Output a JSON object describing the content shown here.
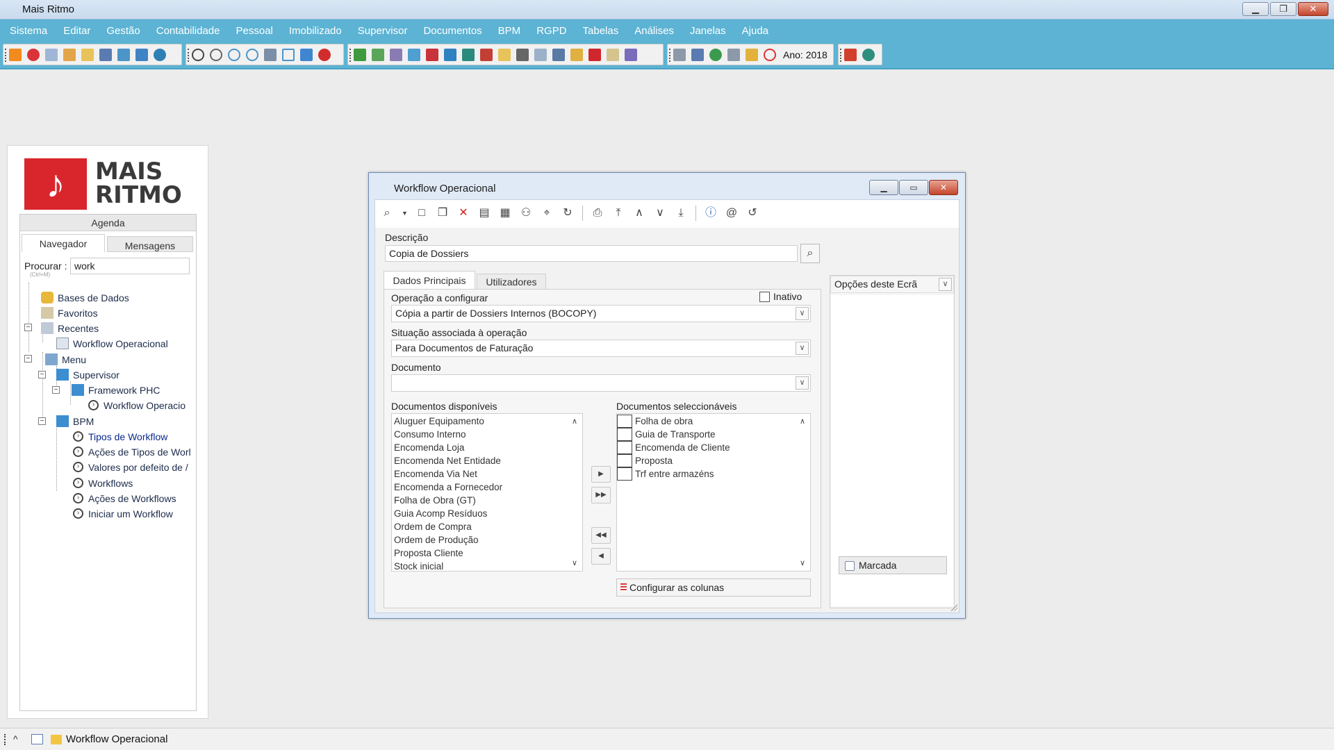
{
  "app": {
    "title": "Mais Ritmo",
    "window_controls": {
      "minimize": "▁",
      "restore": "❐",
      "close": "✕"
    }
  },
  "menu": [
    "Sistema",
    "Editar",
    "Gestão",
    "Contabilidade",
    "Pessoal",
    "Imobilizado",
    "Supervisor",
    "Documentos",
    "BPM",
    "RGPD",
    "Tabelas",
    "Análises",
    "Janelas",
    "Ajuda"
  ],
  "toolbar": {
    "year_label": "Ano: 2018"
  },
  "navigator": {
    "logo_glyph": "♪",
    "logo_line1": "MAIS",
    "logo_line2": "RITMO",
    "agenda": "Agenda",
    "tab_navigator": "Navegador",
    "tab_messages": "Mensagens",
    "search_label": "Procurar :",
    "search_hint": "(Ctrl+M)",
    "search_value": "work",
    "tree": {
      "bases": "Bases de Dados",
      "favoritos": "Favoritos",
      "recentes": "Recentes",
      "recent_workflow": "Workflow Operacional",
      "menu": "Menu",
      "supervisor": "Supervisor",
      "framework": "Framework PHC",
      "framework_workflow": "Workflow Operacio",
      "bpm": "BPM",
      "bpm_items": [
        "Tipos de Workflow",
        "Ações de Tipos de Worl",
        "Valores por defeito de /",
        "Workflows",
        "Ações de Workflows",
        "Iniciar um Workflow"
      ]
    }
  },
  "dialog": {
    "title": "Workflow Operacional",
    "controls": {
      "minimize": "▁",
      "maximize": "▭",
      "close": "✕"
    },
    "descricao_label": "Descrição",
    "descricao_value": "Copia de Dossiers",
    "tab_main": "Dados Principais",
    "tab_users": "Utilizadores",
    "operacao_label": "Operação a configurar",
    "inativo_label": "Inativo",
    "operacao_value": "Cópia a partir de Dossiers Internos (BOCOPY)",
    "situacao_label": "Situação associada à operação",
    "situacao_value": "Para Documentos de Faturação",
    "documento_label": "Documento",
    "documento_value": "",
    "disponiveis_label": "Documentos disponíveis",
    "disponiveis": [
      "Aluguer Equipamento",
      "Consumo Interno",
      "Encomenda Loja",
      "Encomenda Net Entidade",
      "Encomenda Via Net",
      "Encomenda a Fornecedor",
      "Folha de Obra (GT)",
      "Guia Acomp Resíduos",
      "Ordem de Compra",
      "Ordem de Produção",
      "Proposta Cliente",
      "Stock inicial"
    ],
    "seleccionaveis_label": "Documentos seleccionáveis",
    "seleccionaveis": [
      "Folha de obra",
      "Guia de Transporte",
      "Encomenda de Cliente",
      "Proposta",
      "Trf entre armazéns"
    ],
    "move_buttons": {
      "add_one": "▶",
      "add_all": "▶▶",
      "remove_all": "◀◀",
      "remove_one": "◀"
    },
    "config_columns": "Configurar as colunas",
    "opcoes_label": "Opções deste Ecrã",
    "marcada_label": "Marcada"
  },
  "statusbar": {
    "task": "Workflow Operacional",
    "up_glyph": "^"
  },
  "colors": {
    "menubar": "#5cb3d3",
    "logo_red": "#d9262c"
  }
}
